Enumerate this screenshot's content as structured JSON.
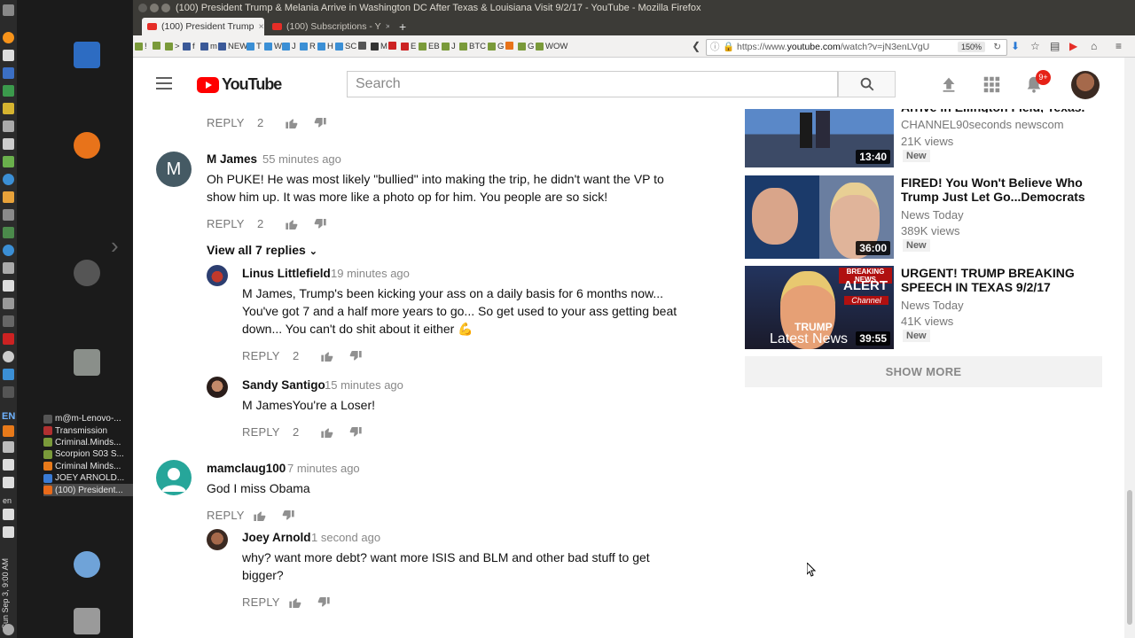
{
  "os": {
    "clock": "Sun Sep 3, 9:00 AM",
    "lang": "EN",
    "lang_small": "en"
  },
  "taskbar": [
    {
      "label": "m@m-Lenovo-...",
      "color": "#555555"
    },
    {
      "label": "Transmission",
      "color": "#b03030"
    },
    {
      "label": "Criminal.Minds...",
      "color": "#7a9a3a"
    },
    {
      "label": "Scorpion S03 S...",
      "color": "#7a9a3a"
    },
    {
      "label": "Criminal Minds...",
      "color": "#e87a1a"
    },
    {
      "label": "JOEY ARNOLD...",
      "color": "#3a7bd5"
    },
    {
      "label": "(100) President...",
      "color": "#e86a1a"
    }
  ],
  "browser": {
    "window_title": "(100) President Trump & Melania Arrive in Washington DC After Texas & Louisiana Visit 9/2/17 - YouTube - Mozilla Firefox",
    "tabs": [
      {
        "label": "(100) President Trump"
      },
      {
        "label": "(100) Subscriptions - Y"
      }
    ],
    "new_tab": "+",
    "bookmarks": [
      "!",
      "",
      ">",
      "f",
      "m",
      "NEW",
      "T",
      "W",
      "J",
      "R",
      "H",
      "SC",
      "",
      "M",
      "",
      "E",
      "EB",
      "J",
      "BTC",
      "G",
      "",
      "G",
      "WOW"
    ],
    "url_prefix": "https://www.",
    "url_domain": "youtube.com",
    "url_rest": "/watch?v=jN3enLVgU",
    "zoom": "150%"
  },
  "youtube": {
    "logo_text": "YouTube",
    "search_placeholder": "Search",
    "notif_count": "9+",
    "brand_red": "#ff0000"
  },
  "comments": {
    "top_reply": {
      "reply": "REPLY",
      "likes": "2"
    },
    "c1": {
      "author": "M James",
      "time": "55 minutes ago",
      "text": "Oh PUKE!  He was most likely \"bullied\" into making the trip, he didn't want the VP to show him up.  It was more like a photo op for him.  You people are so sick!",
      "reply": "REPLY",
      "likes": "2",
      "avatar_letter": "M",
      "avatar_color": "#455a64"
    },
    "view_replies": "View all 7 replies",
    "r1": {
      "author": "Linus Littlefield",
      "time": "19 minutes ago",
      "text": "M James, Trump's been kicking your ass on a daily basis for 6 months now... You've got 7 and a half more years to go... So get used to your ass getting beat down... You can't do shit about it either 💪",
      "reply": "REPLY",
      "likes": "2"
    },
    "r2": {
      "author": "Sandy Santigo",
      "time": "15 minutes ago",
      "text": "M JamesYou're a Loser!",
      "reply": "REPLY",
      "likes": "2"
    },
    "c2": {
      "author": "mamclaug100",
      "time": "7 minutes ago",
      "text": "God I miss Obama",
      "reply": "REPLY",
      "avatar_color": "#26a69a"
    },
    "r3": {
      "author": "Joey Arnold",
      "time": "1 second ago",
      "text": "why? want more debt? want more ISIS and BLM and other bad stuff to get bigger?",
      "reply": "REPLY"
    }
  },
  "sidebar": {
    "videos": [
      {
        "title": "Arrive in Ellington Field, Texas.",
        "channel": "CHANNEL90seconds newscom",
        "views": "21K views",
        "badge": "New",
        "duration": "13:40"
      },
      {
        "title": "FIRED! You Won't Believe Who Trump Just Let Go...Democrats",
        "channel": "News Today",
        "views": "389K views",
        "badge": "New",
        "duration": "36:00"
      },
      {
        "title": "URGENT! TRUMP BREAKING SPEECH IN TEXAS 9/2/17",
        "channel": "News Today",
        "views": "41K views",
        "badge": "New",
        "duration": "39:55",
        "thumb_text_1": "BREAKING NEWS",
        "thumb_text_2": "ALERT",
        "thumb_text_3": "Channel",
        "thumb_text_4": "TRUMP",
        "thumb_text_5": "Latest News"
      }
    ],
    "show_more": "SHOW MORE"
  }
}
